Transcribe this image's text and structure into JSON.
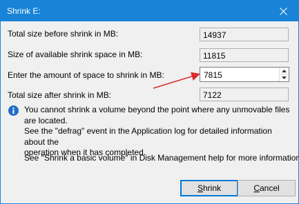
{
  "window": {
    "title": "Shrink E:"
  },
  "fields": {
    "total_size_label": "Total size before shrink in MB:",
    "total_size_value": "14937",
    "available_label": "Size of available shrink space in MB:",
    "available_value": "11815",
    "amount_label": "Enter the amount of space to shrink in MB:",
    "amount_value": "7815",
    "after_label": "Total size after shrink in MB:",
    "after_value": "7122"
  },
  "info": {
    "line1": "You cannot shrink a volume beyond the point where any unmovable files are located.",
    "line2": "See the \"defrag\" event in the Application log for detailed information about the",
    "line3": "operation when it has completed."
  },
  "help": "See \"Shrink a basic volume\" in Disk Management help for more information",
  "buttons": {
    "shrink_mnemonic": "S",
    "shrink_rest": "hrink",
    "cancel_mnemonic": "C",
    "cancel_rest": "ancel"
  },
  "colors": {
    "titlebar": "#1883d7",
    "arrow": "#d92b2b",
    "info_icon": "#1f6fc7"
  },
  "icons": {
    "close": "close-icon",
    "info": "info-icon",
    "spin_up": "spin-up-icon",
    "spin_down": "spin-down-icon"
  }
}
